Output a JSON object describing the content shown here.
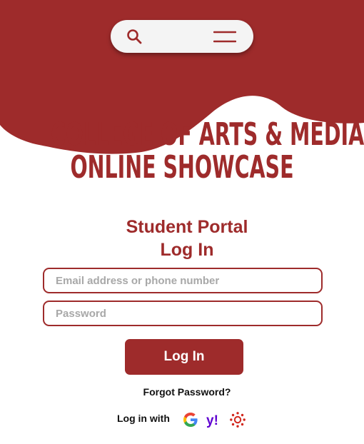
{
  "header": {
    "search_icon": "search-icon",
    "menu_icon": "hamburger-menu-icon",
    "brand_color": "#9e2b2b"
  },
  "hero": {
    "title_line1": "COLLEGE OF ARTS & MEDIA",
    "title_line2": "ONLINE SHOWCASE"
  },
  "portal": {
    "heading_line1": "Student Portal",
    "heading_line2": "Log In",
    "email_placeholder": "Email address or phone number",
    "password_placeholder": "Password",
    "login_button": "Log In",
    "forgot_link": "Forgot Password?",
    "social_label": "Log in with",
    "social_providers": [
      "google-icon",
      "yahoo-icon",
      "canvas-icon"
    ]
  }
}
